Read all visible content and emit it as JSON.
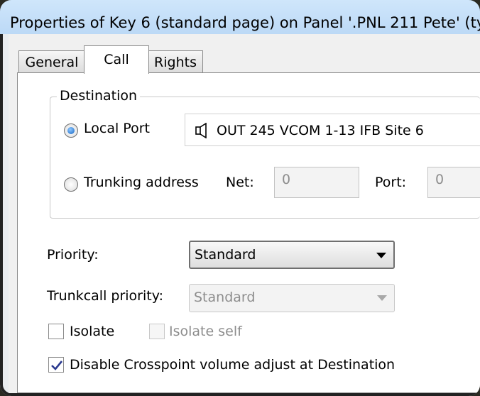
{
  "window": {
    "title": "Properties of Key 6 (standard page) on Panel '.PNL 211 Pete' (ty"
  },
  "tabs": [
    {
      "label": "General",
      "active": false
    },
    {
      "label": "Call",
      "active": true
    },
    {
      "label": "Rights",
      "active": false
    }
  ],
  "destination": {
    "group_label": "Destination",
    "local_port": {
      "label": "Local Port",
      "selected": true,
      "value": "OUT 245 VCOM 1-13 IFB Site 6",
      "icon": "speaker-icon"
    },
    "trunking": {
      "label": "Trunking address",
      "selected": false,
      "net_label": "Net:",
      "net_value": "0",
      "port_label": "Port:",
      "port_value": "0"
    }
  },
  "priority": {
    "label": "Priority:",
    "value": "Standard"
  },
  "trunkcall_priority": {
    "label": "Trunkcall priority:",
    "value": "Standard"
  },
  "options": {
    "isolate": {
      "label": "Isolate",
      "checked": false
    },
    "isolate_self": {
      "label": "Isolate self",
      "checked": false
    },
    "disable_crosspoint": {
      "label": "Disable Crosspoint volume adjust at Destination",
      "checked": true
    }
  },
  "colors": {
    "titlebar": "#c4dff8",
    "radio_dot": "#1766c2",
    "disabled_text": "#8d8d8d"
  }
}
